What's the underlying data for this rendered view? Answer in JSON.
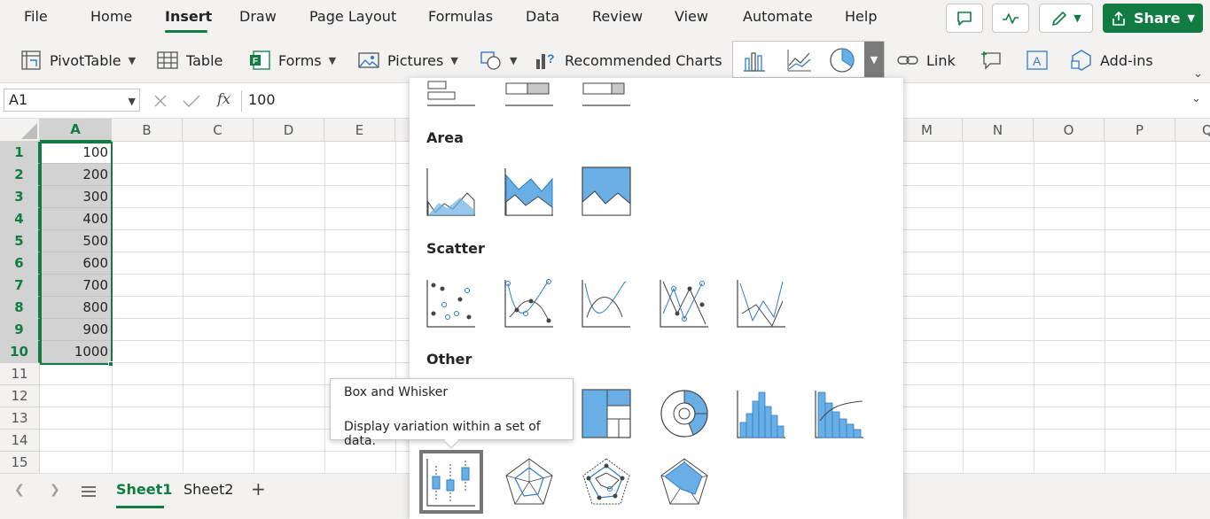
{
  "menu": {
    "tabs": [
      "File",
      "Home",
      "Insert",
      "Draw",
      "Page Layout",
      "Formulas",
      "Data",
      "Review",
      "View",
      "Automate",
      "Help"
    ],
    "active": "Insert",
    "share_label": "Share"
  },
  "ribbon": {
    "pivottable": "PivotTable",
    "table": "Table",
    "forms": "Forms",
    "pictures": "Pictures",
    "recommended_charts": "Recommended Charts",
    "link": "Link",
    "addins": "Add-ins"
  },
  "formula_bar": {
    "name_box": "A1",
    "formula": "100",
    "fx": "fx"
  },
  "grid": {
    "columns": [
      "A",
      "B",
      "C",
      "D",
      "E",
      "M",
      "N",
      "O",
      "P",
      "Q"
    ],
    "rows": [
      "1",
      "2",
      "3",
      "4",
      "5",
      "6",
      "7",
      "8",
      "9",
      "10",
      "11",
      "12",
      "13",
      "14",
      "15"
    ],
    "column_a_values": [
      "100",
      "200",
      "300",
      "400",
      "500",
      "600",
      "700",
      "800",
      "900",
      "1000"
    ]
  },
  "gallery": {
    "sections": {
      "area": "Area",
      "scatter": "Scatter",
      "other": "Other"
    }
  },
  "tooltip": {
    "title": "Box and Whisker",
    "description": "Display variation within a set of data."
  },
  "sheets": {
    "tabs": [
      "Sheet1",
      "Sheet2"
    ],
    "active": "Sheet1",
    "add": "+"
  },
  "colors": {
    "accent": "#107c41",
    "chart_blue": "#69afe5",
    "chart_gray": "#c8c8c8"
  }
}
